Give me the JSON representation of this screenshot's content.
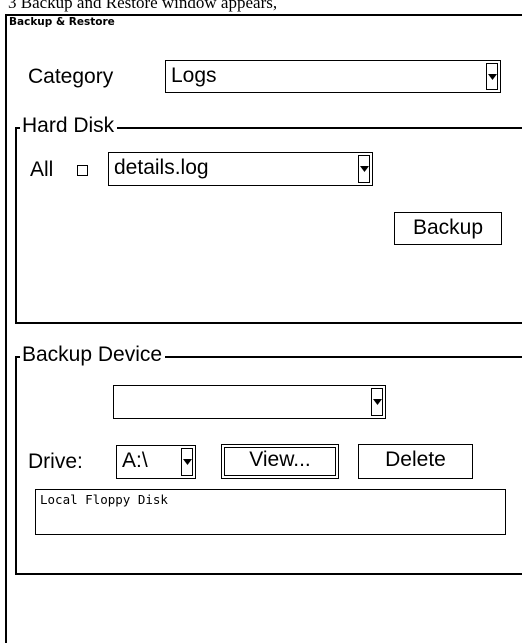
{
  "caption_text": "3 Backup and Restore window appears,",
  "window": {
    "title": "Backup & Restore"
  },
  "category": {
    "label": "Category",
    "value": "Logs"
  },
  "hard_disk": {
    "group_label": "Hard Disk",
    "all_label": "All",
    "all_checked": false,
    "file_value": "details.log",
    "backup_button": "Backup"
  },
  "backup_device": {
    "group_label": "Backup Device",
    "device_value": "",
    "drive_label": "Drive:",
    "drive_value": "A:\\",
    "view_button": "View...",
    "delete_button": "Delete",
    "description": "Local Floppy Disk"
  },
  "icons": {
    "dropdown": "chevron-down-icon",
    "checkbox": "checkbox-icon"
  }
}
